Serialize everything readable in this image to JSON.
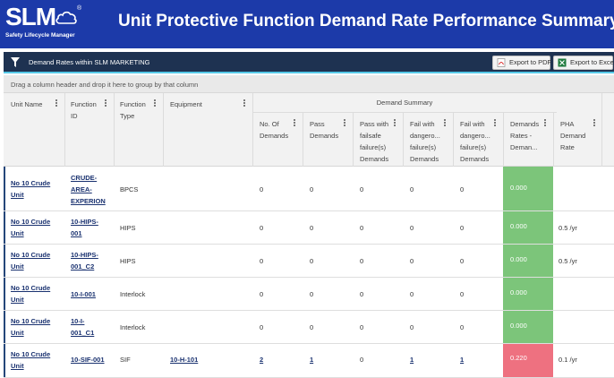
{
  "app": {
    "logo_text": "SLM",
    "logo_reg": "®",
    "logo_subtitle": "Safety Lifecycle Manager",
    "page_title": "Unit Protective Function Demand Rate Performance Summary"
  },
  "toolbar": {
    "title": "Demand Rates within SLM MARKETING",
    "export_pdf_label": "Export to PDF",
    "export_excel_label": "Export to Excel"
  },
  "group_panel_hint": "Drag a column header and drop it here to group by that column",
  "columns": {
    "unit_name": "Unit Name",
    "function_id": [
      "Function",
      "ID"
    ],
    "function_type": [
      "Function",
      "Type"
    ],
    "equipment": "Equipment",
    "demand_summary": "Demand Summary",
    "no_of_demands": [
      "No. Of",
      "Demands"
    ],
    "pass_demands": [
      "Pass",
      "Demands"
    ],
    "pass_failsafe": [
      "Pass with",
      "failsafe",
      "failure(s)",
      "Demands"
    ],
    "fail_dangerous_1": [
      "Fail with",
      "dangero...",
      "failure(s)",
      "Demands"
    ],
    "fail_dangerous_2": [
      "Fail with",
      "dangero...",
      "failure(s)",
      "Demands"
    ],
    "demand_rates": [
      "Demands",
      "Rates -",
      "Deman..."
    ],
    "pha_demand_rate": [
      "PHA",
      "Demand",
      "Rate"
    ]
  },
  "rows": [
    {
      "unit": [
        "No 10 Crude",
        "Unit"
      ],
      "function_id": [
        "CRUDE-",
        "AREA-",
        "EXPERION"
      ],
      "function_type": "BPCS",
      "equipment": "",
      "no_demands": "0",
      "pass": "0",
      "pass_failsafe": "0",
      "fail_d1": "0",
      "fail_d2": "0",
      "demand_rate": "0.000",
      "demand_rate_status": "good",
      "pha": ""
    },
    {
      "unit": [
        "No 10 Crude",
        "Unit"
      ],
      "function_id": [
        "10-HIPS-",
        "001"
      ],
      "function_type": "HIPS",
      "equipment": "",
      "no_demands": "0",
      "pass": "0",
      "pass_failsafe": "0",
      "fail_d1": "0",
      "fail_d2": "0",
      "demand_rate": "0.000",
      "demand_rate_status": "good",
      "pha": "0.5 /yr"
    },
    {
      "unit": [
        "No 10 Crude",
        "Unit"
      ],
      "function_id": [
        "10-HIPS-",
        "001_C2"
      ],
      "function_type": "HIPS",
      "equipment": "",
      "no_demands": "0",
      "pass": "0",
      "pass_failsafe": "0",
      "fail_d1": "0",
      "fail_d2": "0",
      "demand_rate": "0.000",
      "demand_rate_status": "good",
      "pha": "0.5 /yr"
    },
    {
      "unit": [
        "No 10 Crude",
        "Unit"
      ],
      "function_id": [
        "10-I-001"
      ],
      "function_type": "Interlock",
      "equipment": "",
      "no_demands": "0",
      "pass": "0",
      "pass_failsafe": "0",
      "fail_d1": "0",
      "fail_d2": "0",
      "demand_rate": "0.000",
      "demand_rate_status": "good",
      "pha": ""
    },
    {
      "unit": [
        "No 10 Crude",
        "Unit"
      ],
      "function_id": [
        "10-I-",
        "001_C1"
      ],
      "function_type": "Interlock",
      "equipment": "",
      "no_demands": "0",
      "pass": "0",
      "pass_failsafe": "0",
      "fail_d1": "0",
      "fail_d2": "0",
      "demand_rate": "0.000",
      "demand_rate_status": "good",
      "pha": ""
    },
    {
      "unit": [
        "No 10 Crude",
        "Unit"
      ],
      "function_id": [
        "10-SIF-001"
      ],
      "function_type": "SIF",
      "equipment": "10-H-101",
      "no_demands": "2",
      "pass": "1",
      "pass_failsafe": "0",
      "fail_d1": "1",
      "fail_d2": "1",
      "demand_rate": "0.220",
      "demand_rate_status": "bad",
      "pha": "0.1 /yr"
    }
  ],
  "colors": {
    "header_bg": "#1c3aa9",
    "toolbar_bg": "#1e3251",
    "good": "#7cc57a",
    "bad": "#ee7180",
    "link": "#1a3270"
  }
}
